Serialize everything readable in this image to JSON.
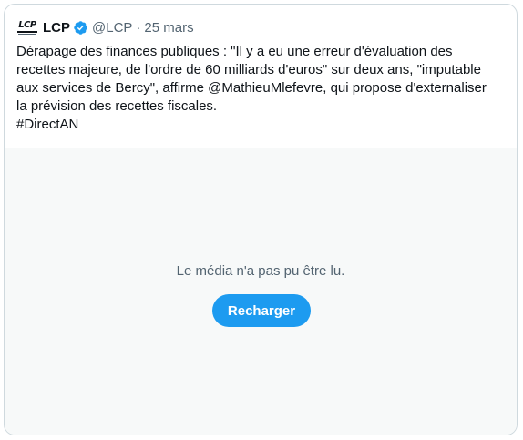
{
  "tweet": {
    "author": {
      "logo_text": "LCP",
      "display_name": "LCP",
      "verified": true,
      "handle": "@LCP",
      "separator": "·",
      "date": "25 mars"
    },
    "text_lines": [
      "Dérapage des finances publiques : \"Il y a eu une erreur d'évaluation des",
      "recettes majeure, de l'ordre de 60 milliards d'euros\" sur deux ans, \"imputable",
      "aux services de Bercy\", affirme @MathieuMlefevre, qui propose d'externaliser",
      "la prévision des recettes fiscales.",
      "#DirectAN"
    ]
  },
  "media": {
    "error_message": "Le média n'a pas pu être lu.",
    "reload_label": "Recharger"
  },
  "colors": {
    "accent": "#1d9bf0",
    "text_primary": "#0f1419",
    "text_secondary": "#536471",
    "media_bg": "#f7f9f9",
    "border": "#cfd9de"
  },
  "icons": {
    "verified": "verified-badge-icon",
    "logo": "lcp-logo"
  }
}
